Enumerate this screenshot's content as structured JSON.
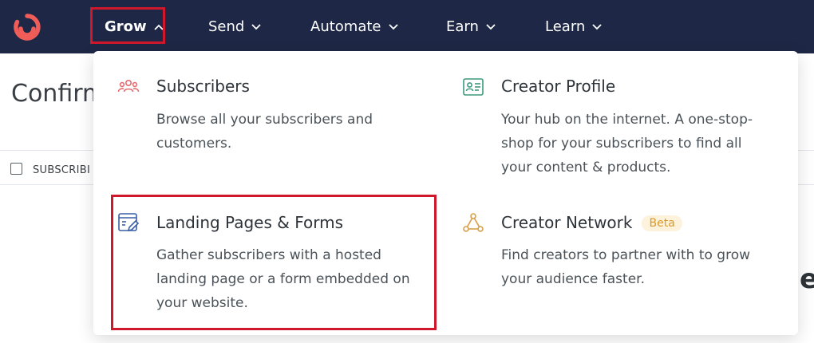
{
  "colors": {
    "nav_bg": "#1e2846",
    "brand": "#f05c58",
    "highlight": "#d0182c",
    "beta_bg": "#fdf2dc",
    "beta_text": "#d89a2c"
  },
  "nav": {
    "items": [
      {
        "label": "Grow",
        "icon": "chevron-up-icon",
        "active": true
      },
      {
        "label": "Send",
        "icon": "chevron-down-icon"
      },
      {
        "label": "Automate",
        "icon": "chevron-down-icon"
      },
      {
        "label": "Earn",
        "icon": "chevron-down-icon"
      },
      {
        "label": "Learn",
        "icon": "chevron-down-icon"
      }
    ]
  },
  "page": {
    "title_partial": "Confirm",
    "column_subscriber": "SUBSCRIBI",
    "bg_letter": "e"
  },
  "dropdown": {
    "items": [
      {
        "title": "Subscribers",
        "icon": "people-icon",
        "description": "Browse all your subscribers and customers."
      },
      {
        "title": "Creator Profile",
        "icon": "id-card-icon",
        "description": "Your hub on the internet. A one-stop-shop for your subscribers to find all your content & products."
      },
      {
        "title": "Landing Pages & Forms",
        "icon": "form-edit-icon",
        "description": "Gather subscribers with a hosted landing page or a form embedded on your website."
      },
      {
        "title": "Creator Network",
        "icon": "network-icon",
        "badge": "Beta",
        "description": "Find creators to partner with to grow your audience faster."
      }
    ]
  }
}
